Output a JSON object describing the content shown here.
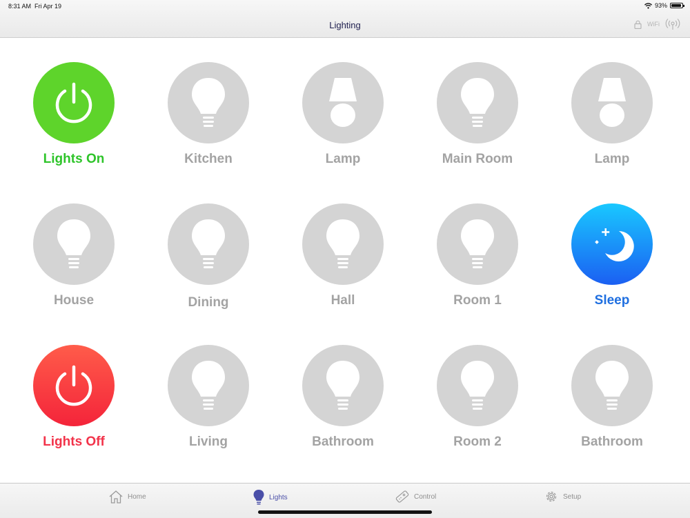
{
  "status": {
    "time": "8:31 AM",
    "date": "Fri Apr 19",
    "battery": "93%"
  },
  "nav": {
    "title": "Lighting",
    "wifi_label": "WiFi"
  },
  "tiles": [
    {
      "label": "Lights On",
      "icon": "power-icon",
      "style": "green"
    },
    {
      "label": "Kitchen",
      "icon": "bulb-icon",
      "style": "gray"
    },
    {
      "label": "Lamp",
      "icon": "lamp-icon",
      "style": "gray"
    },
    {
      "label": "Main Room",
      "icon": "bulb-icon",
      "style": "gray"
    },
    {
      "label": "Lamp",
      "icon": "lamp-icon",
      "style": "gray"
    },
    {
      "label": "House",
      "icon": "bulb-icon",
      "style": "gray"
    },
    {
      "label": "Dining",
      "icon": "bulb-icon",
      "style": "gray"
    },
    {
      "label": "Hall",
      "icon": "bulb-icon",
      "style": "gray"
    },
    {
      "label": "Room 1",
      "icon": "bulb-icon",
      "style": "gray"
    },
    {
      "label": "Sleep",
      "icon": "moon-icon",
      "style": "blue"
    },
    {
      "label": "Lights Off",
      "icon": "power-icon",
      "style": "red"
    },
    {
      "label": "Living",
      "icon": "bulb-icon",
      "style": "gray"
    },
    {
      "label": "Bathroom",
      "icon": "bulb-icon",
      "style": "gray"
    },
    {
      "label": "Room 2",
      "icon": "bulb-icon",
      "style": "gray"
    },
    {
      "label": "Bathroom",
      "icon": "bulb-icon",
      "style": "gray"
    }
  ],
  "tabs": [
    {
      "label": "Home",
      "icon": "home-icon"
    },
    {
      "label": "Lights",
      "icon": "bulb-icon"
    },
    {
      "label": "Control",
      "icon": "remote-icon"
    },
    {
      "label": "Setup",
      "icon": "gear-icon"
    }
  ],
  "colors": {
    "on": "#5ed42b",
    "off": "#f4243a",
    "sleep": "#1b5ff2",
    "inactive_label": "#a3a3a3",
    "active_tab": "#4a4fa8"
  }
}
